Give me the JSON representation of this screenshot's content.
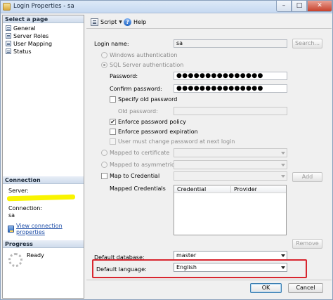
{
  "window": {
    "title": "Login Properties - sa",
    "controls": [
      "–",
      "□",
      "✕"
    ]
  },
  "left_pane": {
    "select_page_header": "Select a page",
    "pages": [
      {
        "label": "General",
        "icon": "page-icon"
      },
      {
        "label": "Server Roles",
        "icon": "page-icon"
      },
      {
        "label": "User Mapping",
        "icon": "page-icon"
      },
      {
        "label": "Status",
        "icon": "page-icon"
      }
    ],
    "connection_header": "Connection",
    "server_label": "Server:",
    "connection_label": "Connection:",
    "connection_value": "sa",
    "view_connection_link": "View connection properties",
    "progress_header": "Progress",
    "progress_status": "Ready"
  },
  "toolbar": {
    "script_label": "Script",
    "help_label": "Help"
  },
  "form": {
    "login_name_label": "Login name:",
    "login_name_value": "sa",
    "search_button": "Search...",
    "windows_auth_label": "Windows authentication",
    "sql_auth_label": "SQL Server authentication",
    "password_label": "Password:",
    "password_value": "●●●●●●●●●●●●●●●",
    "confirm_password_label": "Confirm password:",
    "confirm_password_value": "●●●●●●●●●●●●●●●",
    "specify_old_password_label": "Specify old password",
    "old_password_label": "Old password:",
    "enforce_policy_label": "Enforce password policy",
    "enforce_expiration_label": "Enforce password expiration",
    "must_change_label": "User must change password at next login",
    "mapped_certificate_label": "Mapped to certificate",
    "mapped_asym_key_label": "Mapped to asymmetric key",
    "map_credential_label": "Map to Credential",
    "add_button": "Add",
    "mapped_credentials_label": "Mapped Credentials",
    "grid_columns": [
      "Credential",
      "Provider"
    ],
    "remove_button": "Remove",
    "default_database_label": "Default database:",
    "default_database_value": "master",
    "default_language_label": "Default language:",
    "default_language_value": "English"
  },
  "buttons": {
    "ok": "OK",
    "cancel": "Cancel"
  },
  "colors": {
    "highlight_box": "#d8262f",
    "link": "#1f4fa8",
    "marker": "#f9f400"
  }
}
